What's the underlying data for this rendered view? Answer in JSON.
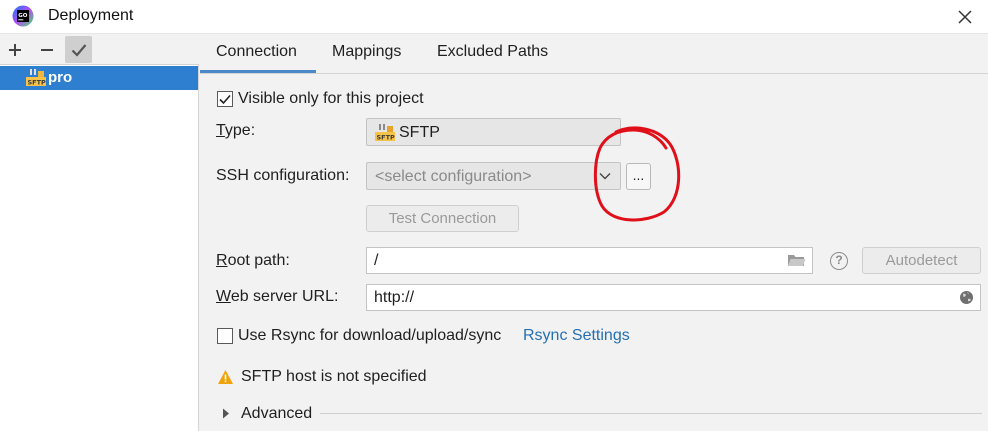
{
  "window": {
    "title": "Deployment",
    "app_icon": "goland-icon"
  },
  "left_toolbar": {
    "add_icon": "plus-icon",
    "remove_icon": "minus-icon",
    "default_icon": "check-icon"
  },
  "tree": {
    "items": [
      {
        "label": "pro",
        "icon": "sftp-icon",
        "selected": true
      }
    ]
  },
  "tabs": [
    {
      "label": "Connection",
      "active": true
    },
    {
      "label": "Mappings",
      "active": false
    },
    {
      "label": "Excluded Paths",
      "active": false
    }
  ],
  "connection": {
    "visible_only_label": "Visible only for this project",
    "visible_only_checked": true,
    "type_label_prefix": "T",
    "type_label_rest": "ype:",
    "type_value": "SFTP",
    "ssh_label_prefix": "SSH configuration:",
    "ssh_placeholder": "<select configuration>",
    "ssh_more_button": "...",
    "test_connection_label": "Test Connection",
    "root_path_label_prefix": "R",
    "root_path_label_rest": "oot path:",
    "root_path_value": "/",
    "autodetect_label": "Autodetect",
    "web_url_label_prefix": "W",
    "web_url_label_rest": "eb server URL:",
    "web_url_value": "http://",
    "rsync_label": "Use Rsync for download/upload/sync",
    "rsync_checked": false,
    "rsync_settings_link": "Rsync Settings",
    "warning_text": "SFTP host is not specified",
    "advanced_label": "Advanced"
  },
  "colors": {
    "selection": "#2f7fd1",
    "link": "#2470b3",
    "tab_underline": "#4a88c7",
    "annotation": "#e0101a"
  }
}
